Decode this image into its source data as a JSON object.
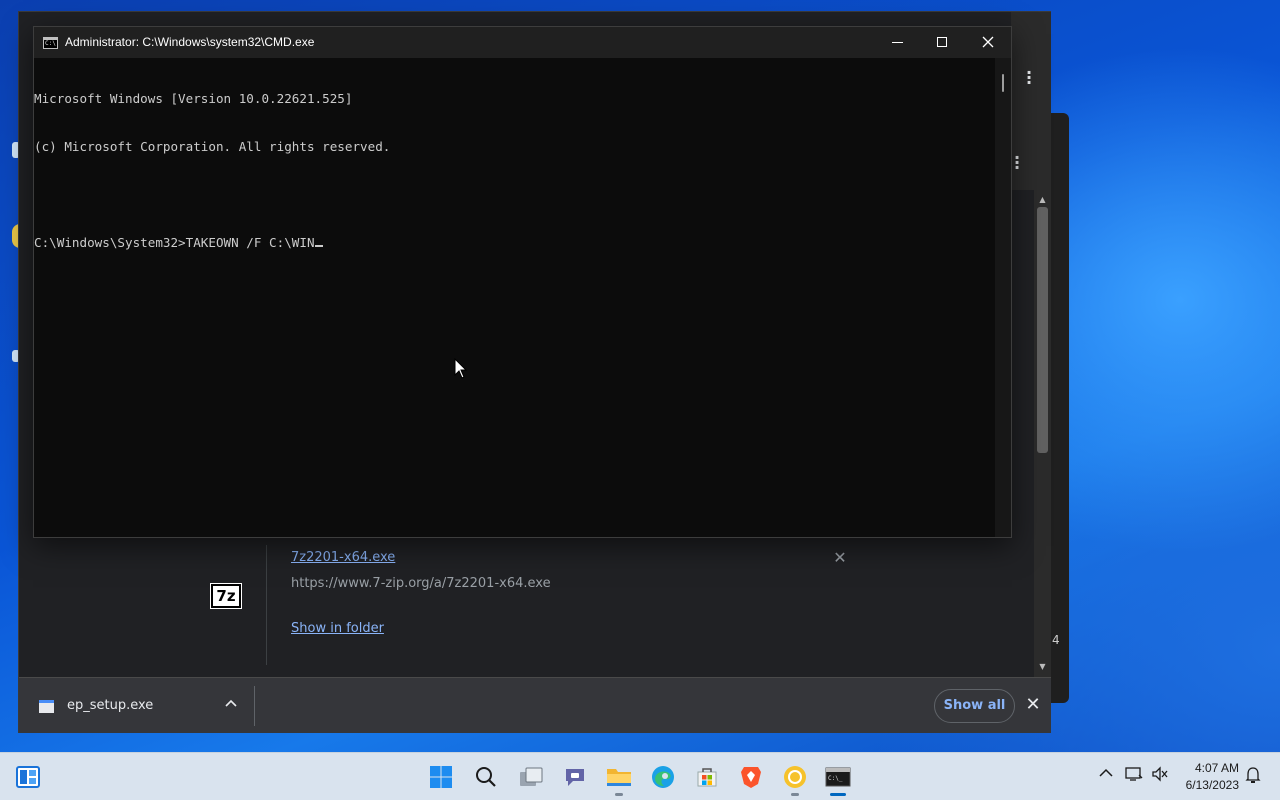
{
  "cmd_window": {
    "title": "Administrator: C:\\Windows\\system32\\CMD.exe",
    "lines": [
      "Microsoft Windows [Version 10.0.22621.525]",
      "(c) Microsoft Corporation. All rights reserved.",
      "",
      "C:\\Windows\\System32>TAKEOWN /F C:\\WIN"
    ]
  },
  "chrome_downloads": {
    "item": {
      "file_name": "7z2201-x64.exe",
      "url": "https://www.7-zip.org/a/7z2201-x64.exe",
      "show_in_folder": "Show in folder",
      "icon_text": "7z"
    },
    "download_bar": {
      "file_name": "ep_setup.exe",
      "show_all": "Show all"
    }
  },
  "side_window": {
    "partial_text": "4"
  },
  "taskbar": {
    "time": "4:07 AM",
    "date": "6/13/2023",
    "apps": [
      "widgets",
      "start",
      "search",
      "task-view",
      "teams-chat",
      "file-explorer",
      "edge",
      "store",
      "brave",
      "chrome",
      "command-prompt"
    ]
  },
  "colors": {
    "cmd_background": "#0c0c0c",
    "cmd_text": "#cccccc",
    "chrome_link": "#8ab4f8",
    "taskbar_background": "#d9e3ee"
  }
}
